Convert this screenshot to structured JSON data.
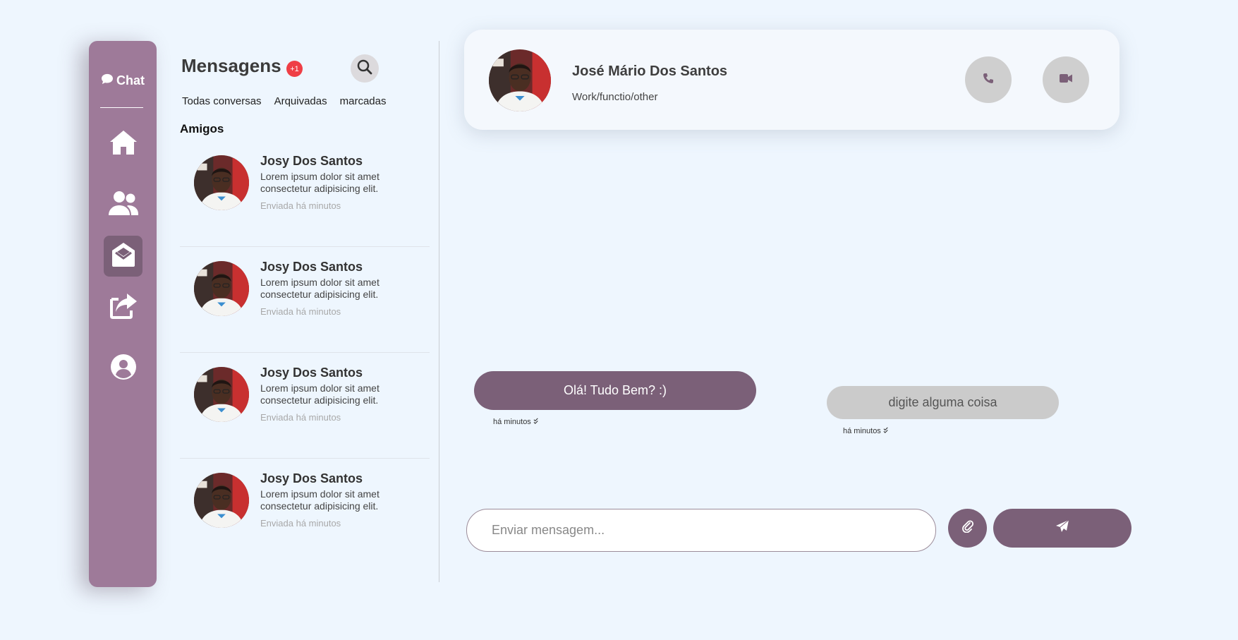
{
  "sidebar": {
    "brand_label": "Chat",
    "items": [
      {
        "icon": "home-icon",
        "label": "home"
      },
      {
        "icon": "users-icon",
        "label": "friends"
      },
      {
        "icon": "envelope-open-icon",
        "label": "messages",
        "active": true
      },
      {
        "icon": "share-icon",
        "label": "share"
      },
      {
        "icon": "user-circle-icon",
        "label": "profile"
      }
    ]
  },
  "list": {
    "title": "Mensagens",
    "badge": "+1",
    "filters": [
      "Todas conversas",
      "Arquivadas",
      "marcadas"
    ],
    "section": "Amigos",
    "conversations": [
      {
        "name": "Josy Dos Santos",
        "preview": "Lorem ipsum dolor sit amet consectetur adipisicing elit.",
        "time": "Enviada há minutos"
      },
      {
        "name": "Josy Dos Santos",
        "preview": "Lorem ipsum dolor sit amet consectetur adipisicing elit.",
        "time": "Enviada há minutos"
      },
      {
        "name": "Josy Dos Santos",
        "preview": "Lorem ipsum dolor sit amet consectetur adipisicing elit.",
        "time": "Enviada há minutos"
      },
      {
        "name": "Josy Dos Santos",
        "preview": "Lorem ipsum dolor sit amet consectetur adipisicing elit.",
        "time": "Enviada há minutos"
      }
    ]
  },
  "chat": {
    "contact_name": "José Mário Dos Santos",
    "contact_subtitle": "Work/functio/other",
    "messages": [
      {
        "text": "Olá! Tudo Bem? :)",
        "time": "há minutos",
        "direction": "out"
      },
      {
        "text": "digite alguma coisa",
        "time": "há minutos",
        "direction": "in"
      }
    ]
  },
  "composer": {
    "placeholder": "Enviar mensagem...",
    "value": ""
  },
  "colors": {
    "accent": "#7b6078",
    "sidebar": "#9e7a99",
    "badge": "#ef3e46",
    "background": "#eef6fe"
  }
}
